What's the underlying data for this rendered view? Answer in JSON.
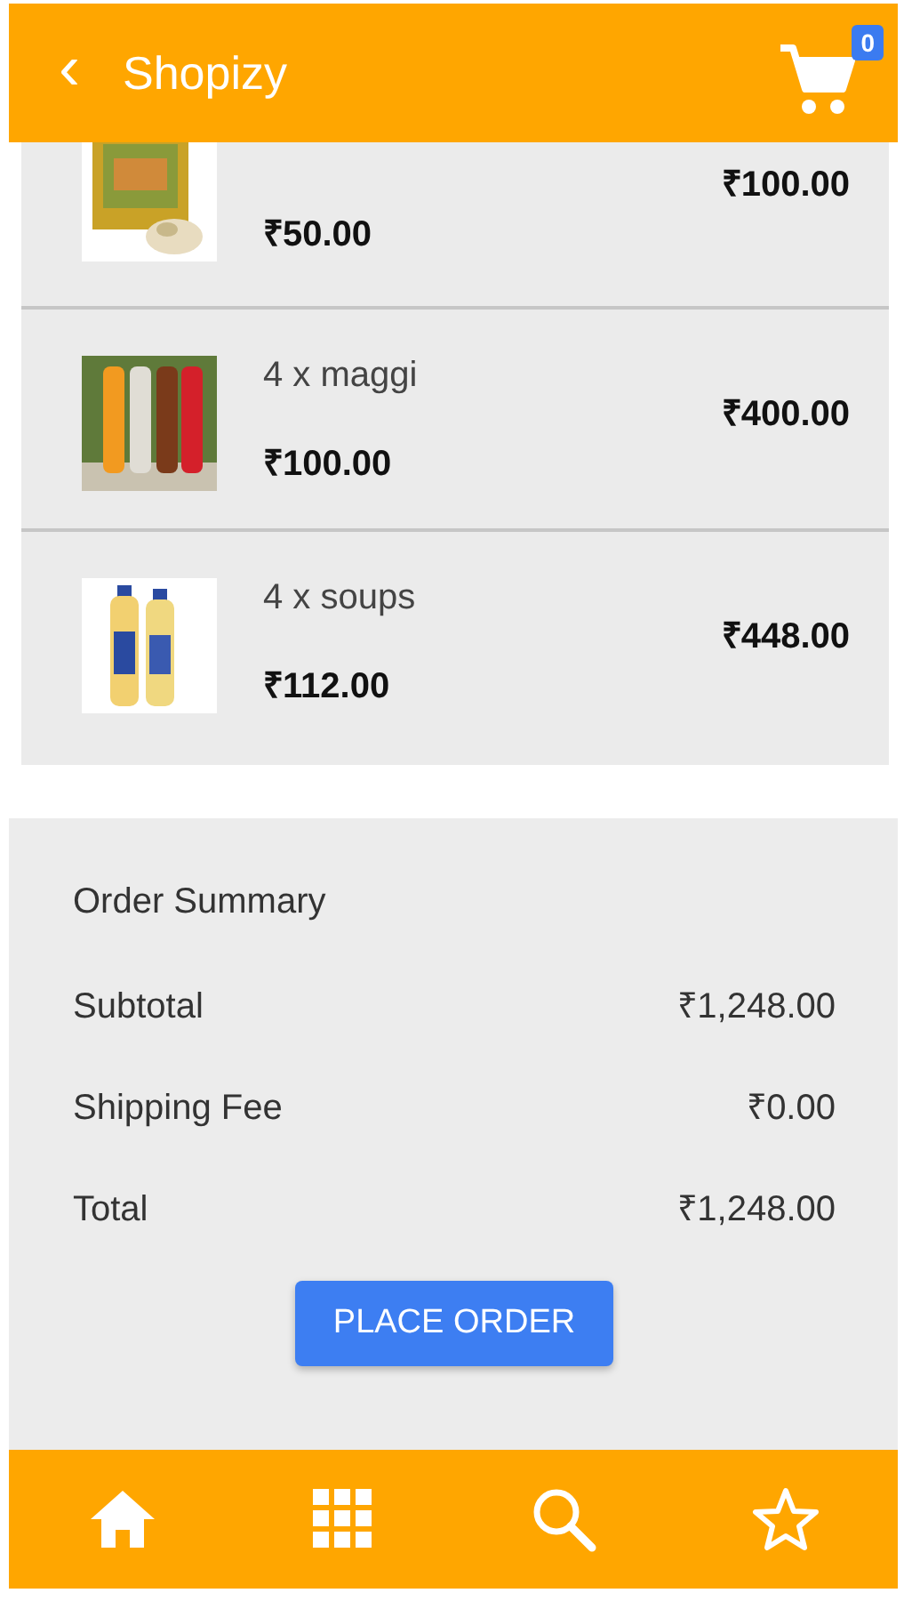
{
  "header": {
    "back": "‹",
    "title": "Shopizy",
    "cart_count": "0"
  },
  "items": [
    {
      "unit_price": "₹50.00",
      "total": "₹100.00"
    },
    {
      "name": "4 x maggi",
      "unit_price": "₹100.00",
      "total": "₹400.00"
    },
    {
      "name": "4 x soups",
      "unit_price": "₹112.00",
      "total": "₹448.00"
    }
  ],
  "summary": {
    "title": "Order Summary",
    "rows": [
      {
        "label": "Subtotal",
        "value": "₹1,248.00"
      },
      {
        "label": "Shipping Fee",
        "value": "₹0.00"
      },
      {
        "label": "Total",
        "value": "₹1,248.00"
      }
    ],
    "button": "PLACE ORDER"
  },
  "bottom_nav": [
    {
      "kind": "home"
    },
    {
      "kind": "grid"
    },
    {
      "kind": "search"
    },
    {
      "kind": "star"
    }
  ]
}
